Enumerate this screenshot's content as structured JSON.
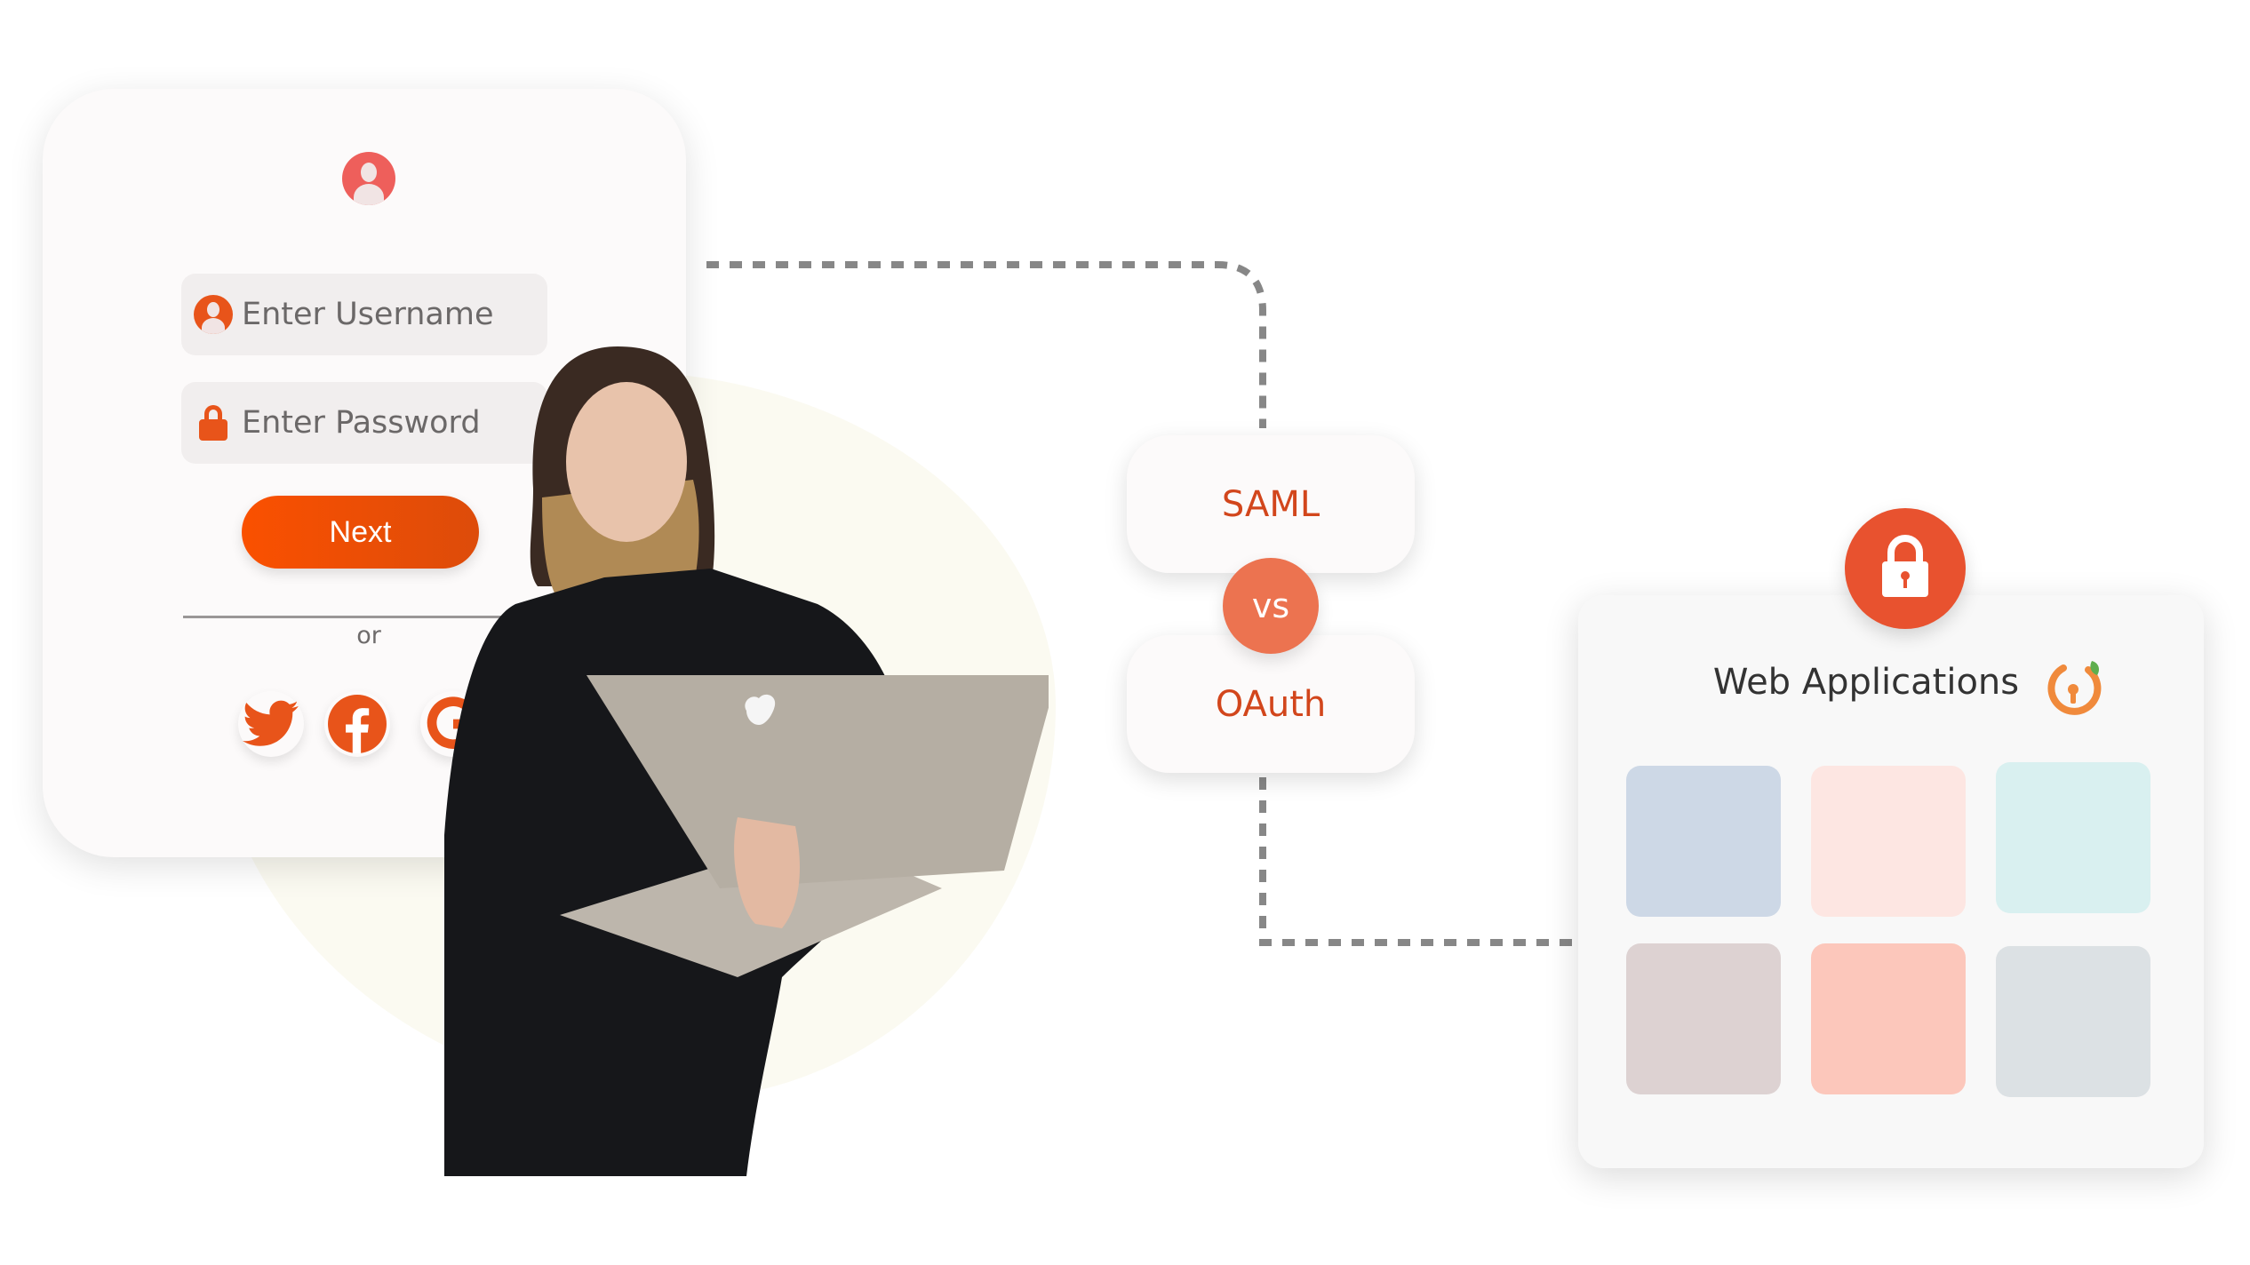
{
  "login_card": {
    "username_placeholder": "Enter Username",
    "password_placeholder": "Enter Password",
    "next_label": "Next",
    "or_label": "or",
    "social": [
      {
        "name": "twitter",
        "icon": "twitter-icon"
      },
      {
        "name": "facebook",
        "icon": "facebook-icon"
      },
      {
        "name": "google",
        "icon": "google-icon"
      }
    ]
  },
  "comparison": {
    "top_label": "SAML",
    "vs_label": "vs",
    "bottom_label": "OAuth"
  },
  "web_apps": {
    "title": "Web Applications",
    "tiles": [
      {
        "color": "#cdd8e6"
      },
      {
        "color": "#fde6e2"
      },
      {
        "color": "#d9f0f0"
      },
      {
        "color": "#ddd2d2"
      },
      {
        "color": "#fcc7bb"
      },
      {
        "color": "#dce1e4"
      }
    ]
  },
  "colors": {
    "accent": "#e8541a",
    "text_accent": "#d2461c",
    "vs_circle": "#ec7350",
    "lock_circle": "#e8522f",
    "dash": "#878787"
  }
}
